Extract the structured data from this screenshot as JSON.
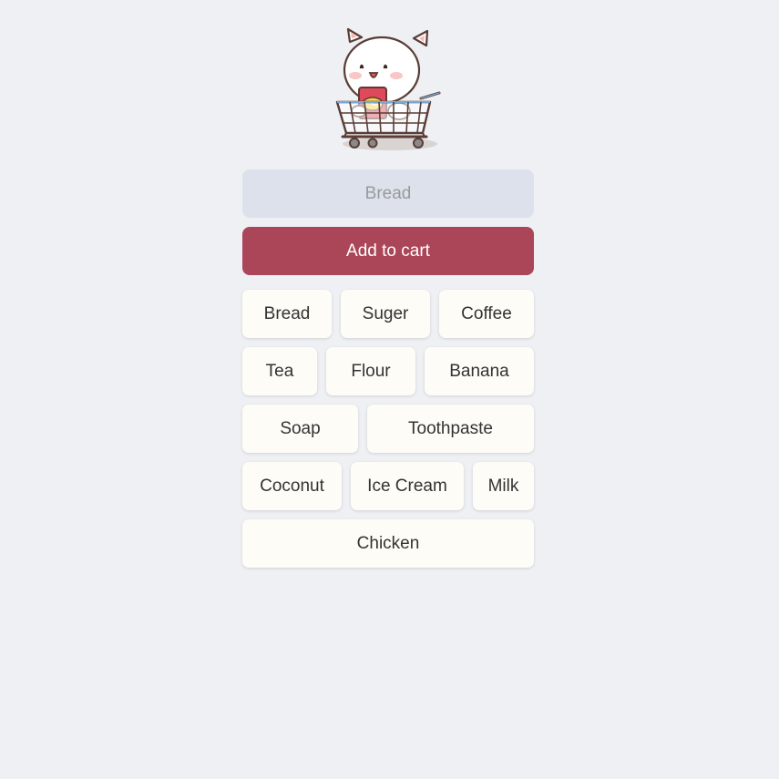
{
  "mascot": {
    "icon": "cat-in-shopping-cart-icon"
  },
  "input": {
    "placeholder": "Bread",
    "value": ""
  },
  "add_button": {
    "label": "Add to cart",
    "color": "#ab4659"
  },
  "items": {
    "row1": [
      "Bread",
      "Suger",
      "Coffee"
    ],
    "row2": [
      "Tea",
      "Flour",
      "Banana"
    ],
    "row3": [
      "Soap",
      "Toothpaste"
    ],
    "row4": [
      "Coconut",
      "Ice Cream",
      "Milk"
    ],
    "row5": [
      "Chicken"
    ]
  },
  "colors": {
    "background": "#eef0f4",
    "input_bg": "#dce1eb",
    "item_bg": "#fdfcf7"
  }
}
